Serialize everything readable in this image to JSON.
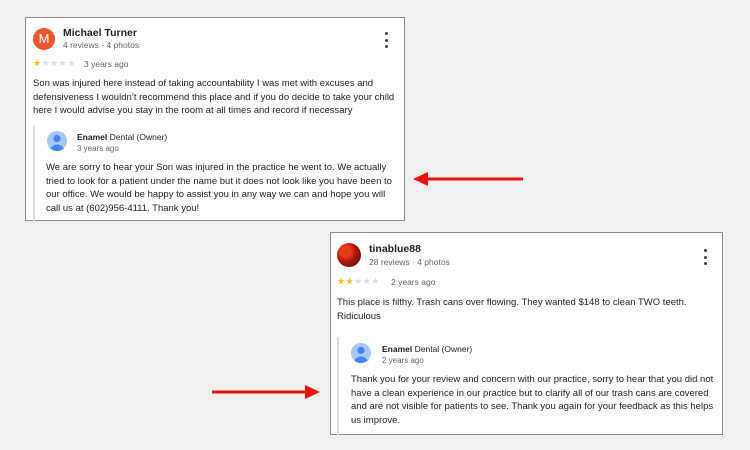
{
  "reviews": [
    {
      "avatar_letter": "M",
      "name": "Michael Turner",
      "meta": "4 reviews · 4 photos",
      "rating": 1,
      "time": "3 years ago",
      "text": "Son was injured here instead of taking accountability I was met with excuses and defensiveness I wouldn’t recommend this place and if you do decide to take your child here I would advise you stay in the room at all times and record if necessary",
      "reply": {
        "owner": "Enamel",
        "owner_role": "Dental (Owner)",
        "time": "3 years ago",
        "text": "We are sorry to hear your Son was injured in the practice he went to. We actually tried to look for a patient under the name but it does not look like you have been to our office. We would be happy to assist you in any way we can and hope you will call us at (602)956-4111. Thank you!"
      }
    },
    {
      "avatar_letter": "",
      "name": "tinablue88",
      "meta": "28 reviews · 4 photos",
      "rating": 2,
      "time": "2 years ago",
      "text": "This place is filthy. Trash cans over flowing. They wanted $148 to clean TWO teeth. Ridiculous",
      "reply": {
        "owner": "Enamel",
        "owner_role": "Dental (Owner)",
        "time": "2 years ago",
        "text": "Thank you for your review and concern with our practice, sorry to hear that you did not have a clean experience in our practice but to clarify all of our trash cans are covered and are not visible for patients to see. Thank you again for your feedback as this helps us improve."
      }
    }
  ],
  "colors": {
    "star_on": "#fbbc04",
    "star_off": "#dadce0",
    "arrow": "#e8130f",
    "avatar_m": "#e8582c"
  },
  "icons": [
    "more-vert-icon",
    "star-icon",
    "owner-avatar-icon",
    "arrow-icon"
  ]
}
